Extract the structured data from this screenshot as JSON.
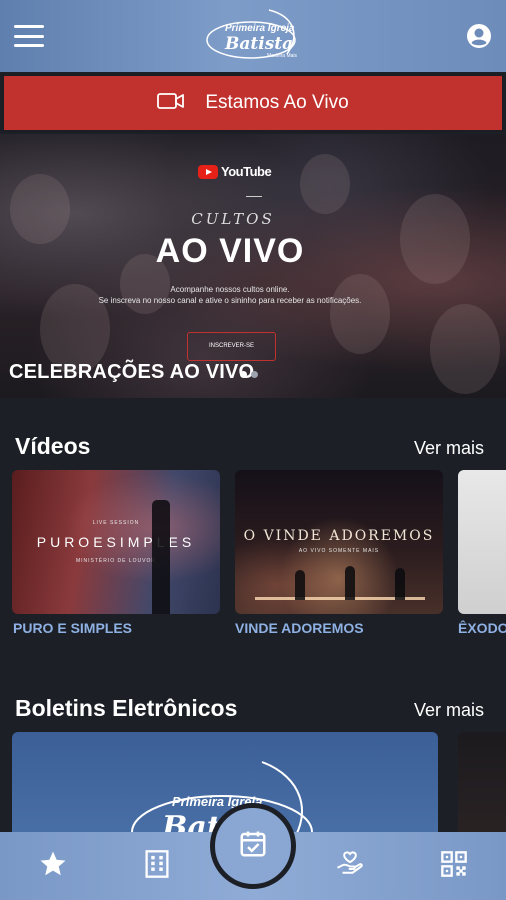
{
  "header": {
    "menu_icon": "hamburger-menu-icon",
    "logo": {
      "line1": "Primeira Igreja",
      "line2": "Batista",
      "line3": "Madeira Mais"
    },
    "profile_icon": "account-circle-icon"
  },
  "live_banner": {
    "icon": "video-camera-icon",
    "label": "Estamos Ao Vivo"
  },
  "hero": {
    "brand": "YouTube",
    "eyebrow": "CULTOS",
    "headline": "AO VIVO",
    "subtitle_line1": "Acompanhe nossos cultos online.",
    "subtitle_line2": "Se inscreva no nosso canal e ative o sininho para receber as notificações.",
    "button": "INSCREVER-SE",
    "caption": "CELEBRAÇÕES AO VIVO",
    "pager": {
      "count": 2,
      "active_index": 0
    }
  },
  "videos": {
    "title": "Vídeos",
    "more": "Ver mais",
    "items": [
      {
        "label": "PURO E SIMPLES",
        "overlay_top": "LIVE SESSION",
        "overlay_main": "PUROESIMPLES",
        "overlay_bottom": "MINISTÉRIO DE LOUVOR"
      },
      {
        "label": "VINDE ADOREMOS",
        "overlay_main": "O VINDE ADOREMOS",
        "overlay_bottom": "AO VIVO SOMENTE MAIS"
      },
      {
        "label": "ÊXODO"
      }
    ]
  },
  "bulletins": {
    "title": "Boletins Eletrônicos",
    "more": "Ver mais",
    "card_line1": "Primeira Igreja",
    "card_line2": "Batista"
  },
  "bottom_nav": {
    "items": [
      {
        "name": "favorites",
        "icon": "star-icon"
      },
      {
        "name": "church",
        "icon": "building-icon"
      },
      {
        "name": "schedule",
        "icon": "calendar-check-icon"
      },
      {
        "name": "donations",
        "icon": "heart-hand-icon"
      },
      {
        "name": "qr-code",
        "icon": "qr-code-icon"
      }
    ]
  },
  "colors": {
    "header": "#7e9cc8",
    "live_banner": "#c1322e",
    "background": "#1c2026",
    "video_label": "#8eb0e2",
    "nav": "#8fabd6"
  }
}
